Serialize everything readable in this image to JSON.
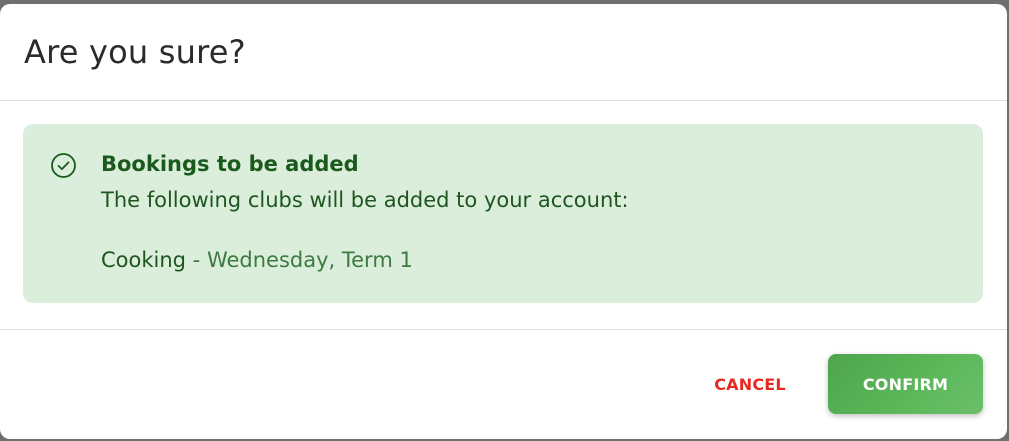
{
  "dialog": {
    "title": "Are you sure?"
  },
  "alert": {
    "icon": "check-circle-icon",
    "color": "#dbeedc",
    "title": "Bookings to be added",
    "message": "The following clubs will be added to your account:",
    "booking": {
      "club": "Cooking",
      "separator": " - ",
      "detail": "Wednesday, Term 1"
    }
  },
  "footer": {
    "cancel_label": "CANCEL",
    "confirm_label": "CONFIRM",
    "cancel_color": "#e52a22",
    "confirm_color": "#5cb85a"
  }
}
